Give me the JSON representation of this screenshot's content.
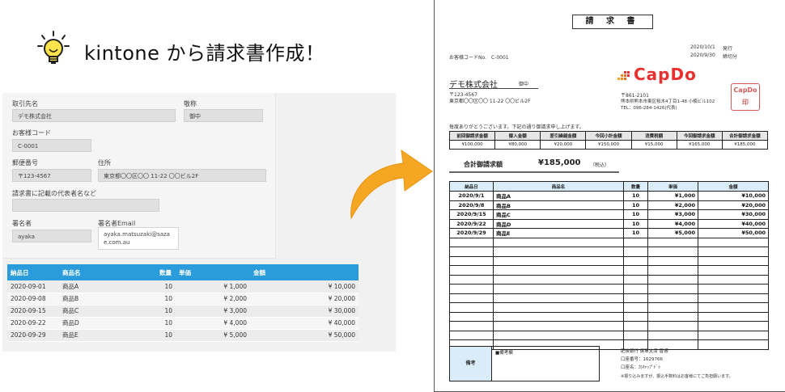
{
  "headline": "kintone から請求書作成！",
  "form": {
    "customer_label": "取引先名",
    "customer_value": "デモ株式会社",
    "honorific_label": "敬称",
    "honorific_value": "御中",
    "code_label": "お客様コード",
    "code_value": "C-0001",
    "zip_label": "郵便番号",
    "zip_value": "〒123-4567",
    "address_label": "住所",
    "address_value": "東京都〇〇区〇〇 11-22 〇〇ビル2F",
    "rep_label": "請求書に記載の代表者名など",
    "rep_value": "",
    "signer_label": "署名者",
    "signer_value": "ayaka",
    "signer_email_label": "署名者Email",
    "signer_email_value": "ayaka.matsuzaki@saza e.com.au"
  },
  "kintone_table": {
    "headers": [
      "納品日",
      "商品名",
      "数量",
      "単価",
      "金額"
    ],
    "rows": [
      [
        "2020-09-01",
        "商品A",
        "10",
        "¥ 1,000",
        "¥ 10,000"
      ],
      [
        "2020-09-08",
        "商品B",
        "10",
        "¥ 2,000",
        "¥ 20,000"
      ],
      [
        "2020-09-15",
        "商品C",
        "10",
        "¥ 3,000",
        "¥ 30,000"
      ],
      [
        "2020-09-22",
        "商品D",
        "10",
        "¥ 4,000",
        "¥ 40,000"
      ],
      [
        "2020-09-29",
        "商品E",
        "10",
        "¥ 5,000",
        "¥ 50,000"
      ]
    ]
  },
  "invoice": {
    "title": "請 求 書",
    "issue_date": "2020/10/1",
    "issue_label": "発行",
    "due_date": "2020/9/30",
    "due_label": "締切分",
    "customer_code": "お客様コードNo.　C-0001",
    "customer_name": "デモ株式会社",
    "honorific": "御中",
    "customer_zip": "〒123-4567",
    "customer_address": "東京都〇〇区〇〇 11-22 〇〇ビル2F",
    "company_logo": "CapDo",
    "company_zip": "〒861-2101",
    "company_address": "熊本県熊本市東区桜木4丁目1-48 小楠ビル102",
    "company_tel": "TEL：096-284-1426(代表)",
    "stamp_line1": "CapDo",
    "stamp_line2": "印",
    "greeting": "毎度ありがとうございます。下記の通り御請求申し上げます。",
    "summary_headers": [
      "前回御請求金額",
      "御入金額",
      "差引繰越金額",
      "今回小計金額",
      "消費税額",
      "今回御請求金額",
      "合計御請求金額"
    ],
    "summary_values": [
      "¥100,000",
      "¥80,000",
      "¥20,000",
      "¥150,000",
      "¥15,000",
      "¥165,000",
      "¥185,000"
    ],
    "total_label": "合計御請求額",
    "total_value": "¥185,000",
    "total_tax": "（税込）",
    "item_headers": [
      "納品日",
      "商品名",
      "数量",
      "単価",
      "金額"
    ],
    "items": [
      [
        "2020/9/1",
        "商品A",
        "10",
        "¥1,000",
        "¥10,000"
      ],
      [
        "2020/9/8",
        "商品B",
        "10",
        "¥2,000",
        "¥20,000"
      ],
      [
        "2020/9/15",
        "商品C",
        "10",
        "¥3,000",
        "¥30,000"
      ],
      [
        "2020/9/22",
        "商品D",
        "10",
        "¥4,000",
        "¥40,000"
      ],
      [
        "2020/9/29",
        "商品E",
        "10",
        "¥5,000",
        "¥50,000"
      ]
    ],
    "remarks_label": "備考",
    "remarks_note": "■備考欄",
    "bank_line1": "肥後銀行 健軍支店 普通",
    "bank_line2": "口座番号：1629766",
    "bank_line3": "口座名：ｶ)ｷｬｯﾌﾟﾄﾞｩ",
    "bank_note": "※振り込みますが、振込手数料はお客様にてご負担願います。"
  },
  "colors": {
    "table_header": "#2a9bdb",
    "logo_red": "#e8302e",
    "arrow": "#f5a623",
    "item_header": "#d9ecf7"
  }
}
